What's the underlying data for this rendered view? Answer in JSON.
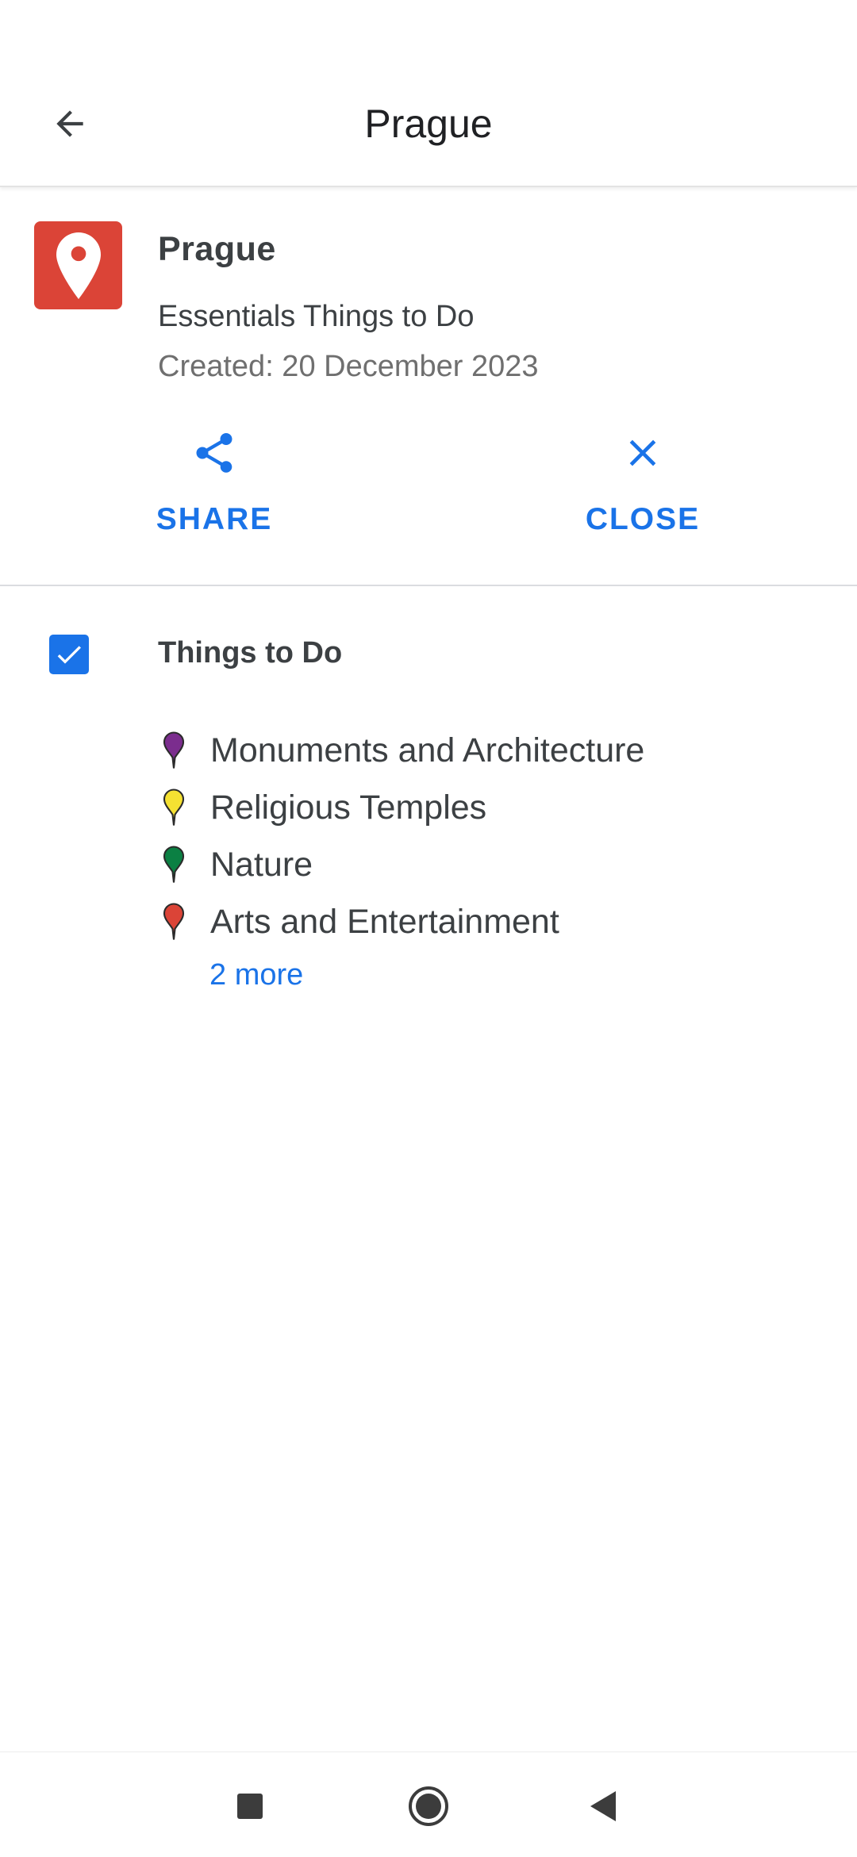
{
  "appbar": {
    "title": "Prague"
  },
  "map": {
    "name": "Prague",
    "description": "Essentials Things to Do",
    "created": "Created: 20 December 2023",
    "icon": "map-pin-icon",
    "icon_color": "#db4437"
  },
  "actions": {
    "share_label": "SHARE",
    "close_label": "CLOSE",
    "accent": "#1a73e8"
  },
  "layer": {
    "title": "Things to Do",
    "checked": true,
    "items": [
      {
        "label": "Monuments and Architecture",
        "pin_color": "#7b2d8e"
      },
      {
        "label": "Religious Temples",
        "pin_color": "#f5e132"
      },
      {
        "label": "Nature",
        "pin_color": "#0b8043"
      },
      {
        "label": "Arts and Entertainment",
        "pin_color": "#db4437"
      }
    ],
    "more_label": "2 more"
  },
  "navbar": {
    "icons": [
      "recents-square-icon",
      "home-circle-icon",
      "back-triangle-icon"
    ]
  }
}
